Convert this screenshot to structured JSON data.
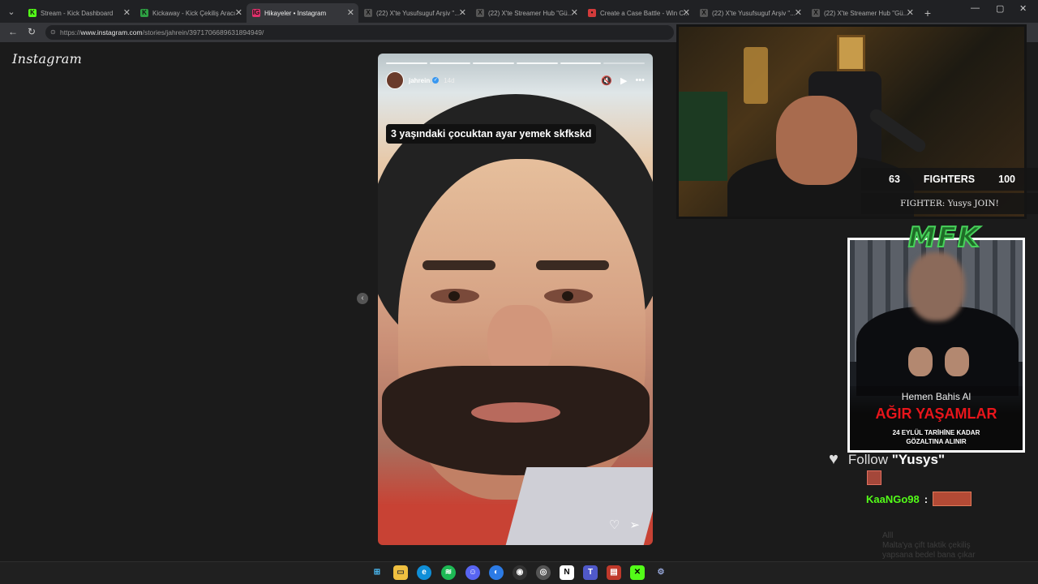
{
  "browser": {
    "tabs": [
      {
        "title": "Stream - Kick Dashboard",
        "favicon": "K",
        "fav_color": "#53fc18",
        "active": false
      },
      {
        "title": "Kickaway - Kick Çekiliş Aracı",
        "favicon": "K",
        "fav_color": "#2ea043",
        "active": false
      },
      {
        "title": "Hikayeler • Instagram",
        "favicon": "IG",
        "fav_color": "#e1306c",
        "active": true
      },
      {
        "title": "(22) X'te Yusufsuguf Arşiv \"...",
        "favicon": "X",
        "fav_color": "#555555",
        "active": false
      },
      {
        "title": "(22) X'te Streamer Hub \"Gü...",
        "favicon": "X",
        "fav_color": "#555555",
        "active": false
      },
      {
        "title": "Create a Case Battle - Win C...",
        "favicon": "•",
        "fav_color": "#d33b3b",
        "active": false
      },
      {
        "title": "(22) X'te Yusufsuguf Arşiv \"...",
        "favicon": "X",
        "fav_color": "#555555",
        "active": false
      },
      {
        "title": "(22) X'te Streamer Hub \"Gü...",
        "favicon": "X",
        "fav_color": "#555555",
        "active": false
      }
    ],
    "url_prefix": "https://",
    "url_host": "www.instagram.com",
    "url_path": "/stories/jahrein/3971706689631894949/"
  },
  "instagram": {
    "logo": "Instagram",
    "story": {
      "username": "jahrein",
      "time_ago": "14d",
      "caption": "3 yaşındaki çocuktan ayar yemek skfkskd",
      "segments_total": 6,
      "segments_viewed": 5
    }
  },
  "stream": {
    "fighters": {
      "left": "63",
      "label": "FIGHTERS",
      "right": "100"
    },
    "fighter_join": "FIGHTER: Yusys JOIN!",
    "logo_text": "MFK",
    "ad": {
      "line1": "Hemen Bahis Al",
      "line2": "AĞIR YAŞAMLAR",
      "line3": "24 EYLÜL TARİHİNE KADAR",
      "line4": "GÖZALTINA ALINIR"
    },
    "follow": {
      "prefix": "Follow",
      "name": "\"Yusys\""
    },
    "chat": {
      "user": "KaaNGo98",
      "colon": ":"
    },
    "faded_chat": [
      "Alll",
      "Malta'ya çift taktik çekiliş",
      "yapsana bedel bana çıkar"
    ]
  },
  "colors": {
    "kick_green": "#53fc18",
    "ad_red": "#e8151b"
  }
}
